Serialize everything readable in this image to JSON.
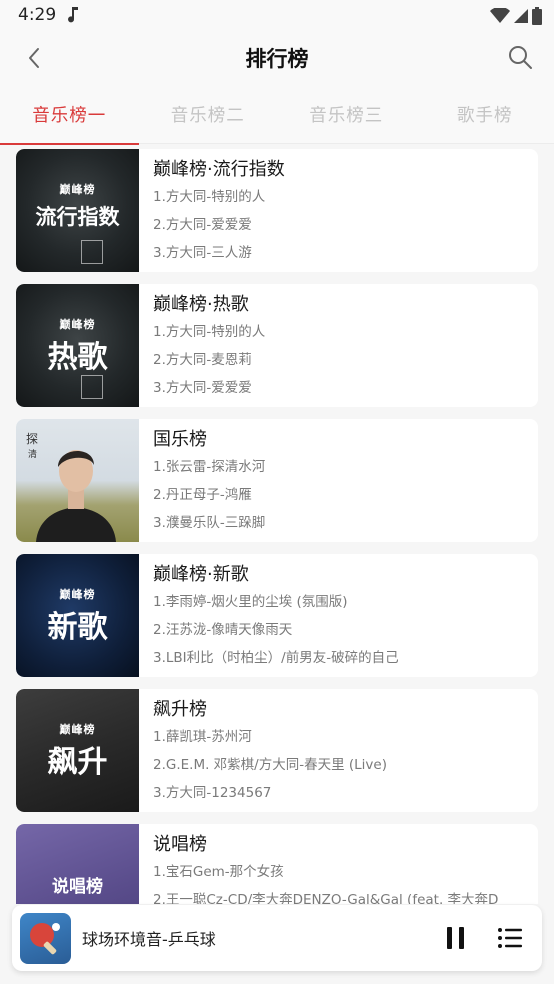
{
  "status": {
    "time": "4:29"
  },
  "header": {
    "title": "排行榜"
  },
  "tabs": [
    "音乐榜一",
    "音乐榜二",
    "音乐榜三",
    "歌手榜"
  ],
  "charts": [
    {
      "title": "巅峰榜·流行指数",
      "cover_logo": "巅峰榜",
      "cover_text": "流行指数",
      "songs": [
        "1.方大同-特别的人",
        "2.方大同-爱爱爱",
        "3.方大同-三人游"
      ]
    },
    {
      "title": "巅峰榜·热歌",
      "cover_logo": "巅峰榜",
      "cover_text": "热歌",
      "songs": [
        "1.方大同-特别的人",
        "2.方大同-麦恩莉",
        "3.方大同-爱爱爱"
      ]
    },
    {
      "title": "国乐榜",
      "cover_text": "",
      "songs": [
        "1.张云雷-探清水河",
        "2.丹正母子-鸿雁",
        "3.濮曼乐队-三跺脚"
      ]
    },
    {
      "title": "巅峰榜·新歌",
      "cover_logo": "巅峰榜",
      "cover_text": "新歌",
      "songs": [
        "1.李雨婷-烟火里的尘埃 (氛围版)",
        "2.汪苏泷-像晴天像雨天",
        "3.LBI利比（时柏尘）/前男友-破碎的自己"
      ]
    },
    {
      "title": "飙升榜",
      "cover_logo": "巅峰榜",
      "cover_text": "飙升",
      "songs": [
        "1.薛凯琪-苏州河",
        "2.G.E.M. 邓紫棋/方大同-春天里 (Live)",
        "3.方大同-1234567"
      ]
    },
    {
      "title": "说唱榜",
      "cover_text": "说唱榜",
      "songs": [
        "1.宝石Gem-那个女孩",
        "2.王一聪Cz-CD/李大奔DENZO-Gal&Gal (feat. 李大奔D"
      ]
    }
  ],
  "player": {
    "title": "球场环境音-乒乓球"
  }
}
